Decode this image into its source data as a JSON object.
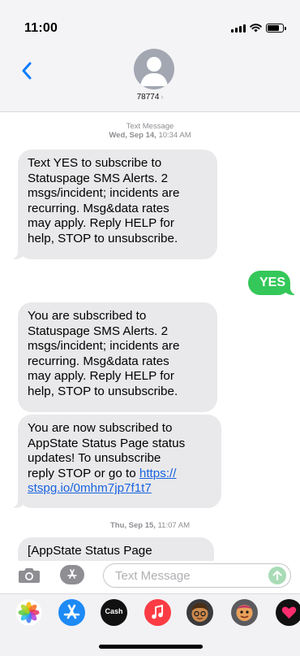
{
  "status_bar": {
    "time": "11:00"
  },
  "header": {
    "contact_name": "78774",
    "contact_chevron": "›"
  },
  "messages": [
    {
      "type": "timestamp",
      "line1": "Text Message",
      "line2_day": "Wed, Sep 14,",
      "line2_time": "10:34 AM"
    },
    {
      "type": "received",
      "text": "Text YES to subscribe to\nStatuspage SMS Alerts. 2\nmsgs/incident; incidents are\nrecurring. Msg&data rates\nmay apply. Reply HELP for\nhelp, STOP to unsubscribe."
    },
    {
      "type": "sent",
      "text": "YES"
    },
    {
      "type": "received",
      "text": "You are subscribed to\nStatuspage SMS Alerts. 2\nmsgs/incident; incidents are\nrecurring. Msg&data rates\nmay apply. Reply HELP for\nhelp, STOP to unsubscribe."
    },
    {
      "type": "received",
      "text": "You are now subscribed to\nAppState Status Page status\nupdates! To unsubscribe\nreply STOP or go to ",
      "link_line1": "https://",
      "link_line2": "stspg.io/0mhm7jp7f1t7"
    },
    {
      "type": "timestamp",
      "line2_day": "Thu, Sep 15,",
      "line2_time": "11:07 AM"
    },
    {
      "type": "received",
      "text": "[AppState Status Page"
    }
  ],
  "input_bar": {
    "placeholder": "Text Message"
  },
  "app_drawer": {
    "apps": [
      {
        "icon": "photos-app-icon",
        "color": "#ffffff"
      },
      {
        "icon": "app-store-icon",
        "color": "#1d8af5"
      },
      {
        "icon": "apple-cash-icon",
        "color": "#111111",
        "label": "Cash"
      },
      {
        "icon": "music-app-icon",
        "color": "#fc3c44"
      },
      {
        "icon": "memoji-icon",
        "color": "#3a3a3c"
      },
      {
        "icon": "animoji-icon",
        "color": "#5b5b5f"
      },
      {
        "icon": "digital-touch-icon",
        "color": "#111111"
      }
    ]
  },
  "colors": {
    "sent_bubble": "#34c759",
    "received_bubble": "#e9e9eb",
    "link": "#1a63e0",
    "ios_blue": "#0a7cff"
  }
}
